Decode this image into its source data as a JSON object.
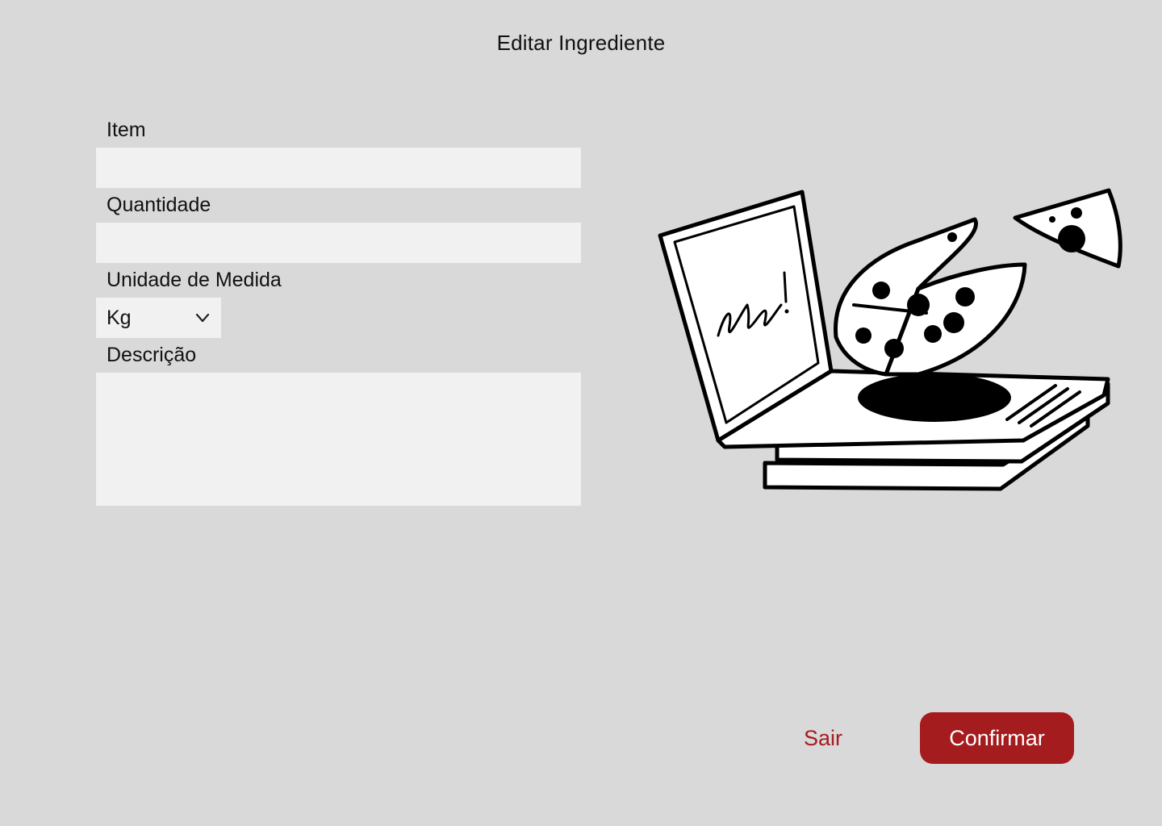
{
  "header": {
    "title": "Editar Ingrediente"
  },
  "form": {
    "item": {
      "label": "Item",
      "value": "",
      "placeholder": ""
    },
    "quantity": {
      "label": "Quantidade",
      "value": "",
      "placeholder": ""
    },
    "unit": {
      "label": "Unidade de Medida",
      "selected": "Kg"
    },
    "description": {
      "label": "Descrição",
      "value": "",
      "placeholder": ""
    }
  },
  "illustration": {
    "icon": "pizza-boxes-illustration",
    "box_lid_scribble": "ee!"
  },
  "actions": {
    "exit_label": "Sair",
    "confirm_label": "Confirmar"
  },
  "colors": {
    "background": "#d9d9d9",
    "field_background": "#f1f1f1",
    "accent": "#a51c1e",
    "text": "#111111"
  }
}
